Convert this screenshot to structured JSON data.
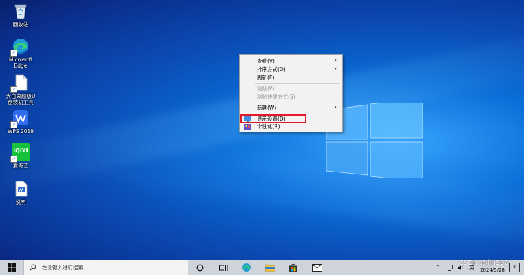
{
  "desktop_icons": [
    {
      "label": "回收站",
      "icon": "recycle-bin-icon"
    },
    {
      "label": "Microsoft\nEdge",
      "icon": "edge-icon"
    },
    {
      "label": "大白菜超级U\n盘装机工具",
      "icon": "document-icon"
    },
    {
      "label": "WPS 2019",
      "icon": "wps-icon"
    },
    {
      "label": "爱奇艺",
      "icon": "iqiyi-icon"
    },
    {
      "label": "说明",
      "icon": "word-doc-icon"
    }
  ],
  "iqiyi_text": "iQIYI",
  "context_menu": {
    "items": [
      {
        "label": "查看(V)",
        "submenu": true,
        "disabled": false
      },
      {
        "label": "排序方式(O)",
        "submenu": true,
        "disabled": false
      },
      {
        "label": "刷新(E)",
        "submenu": false,
        "disabled": false
      },
      {
        "label": "粘贴(P)",
        "submenu": false,
        "disabled": true
      },
      {
        "label": "粘贴快捷方式(S)",
        "submenu": false,
        "disabled": true
      },
      {
        "label": "新建(W)",
        "submenu": true,
        "disabled": false
      },
      {
        "label": "显示设置(D)",
        "submenu": false,
        "disabled": false,
        "highlighted": true
      },
      {
        "label": "个性化(R)",
        "submenu": false,
        "disabled": false
      }
    ],
    "highlight_color": "#e0192b"
  },
  "taskbar": {
    "search_placeholder": "在此键入进行搜索",
    "ime": "英",
    "date": "2024/5/28",
    "notification_count": "3"
  },
  "watermark": "CSDN @ljh302"
}
